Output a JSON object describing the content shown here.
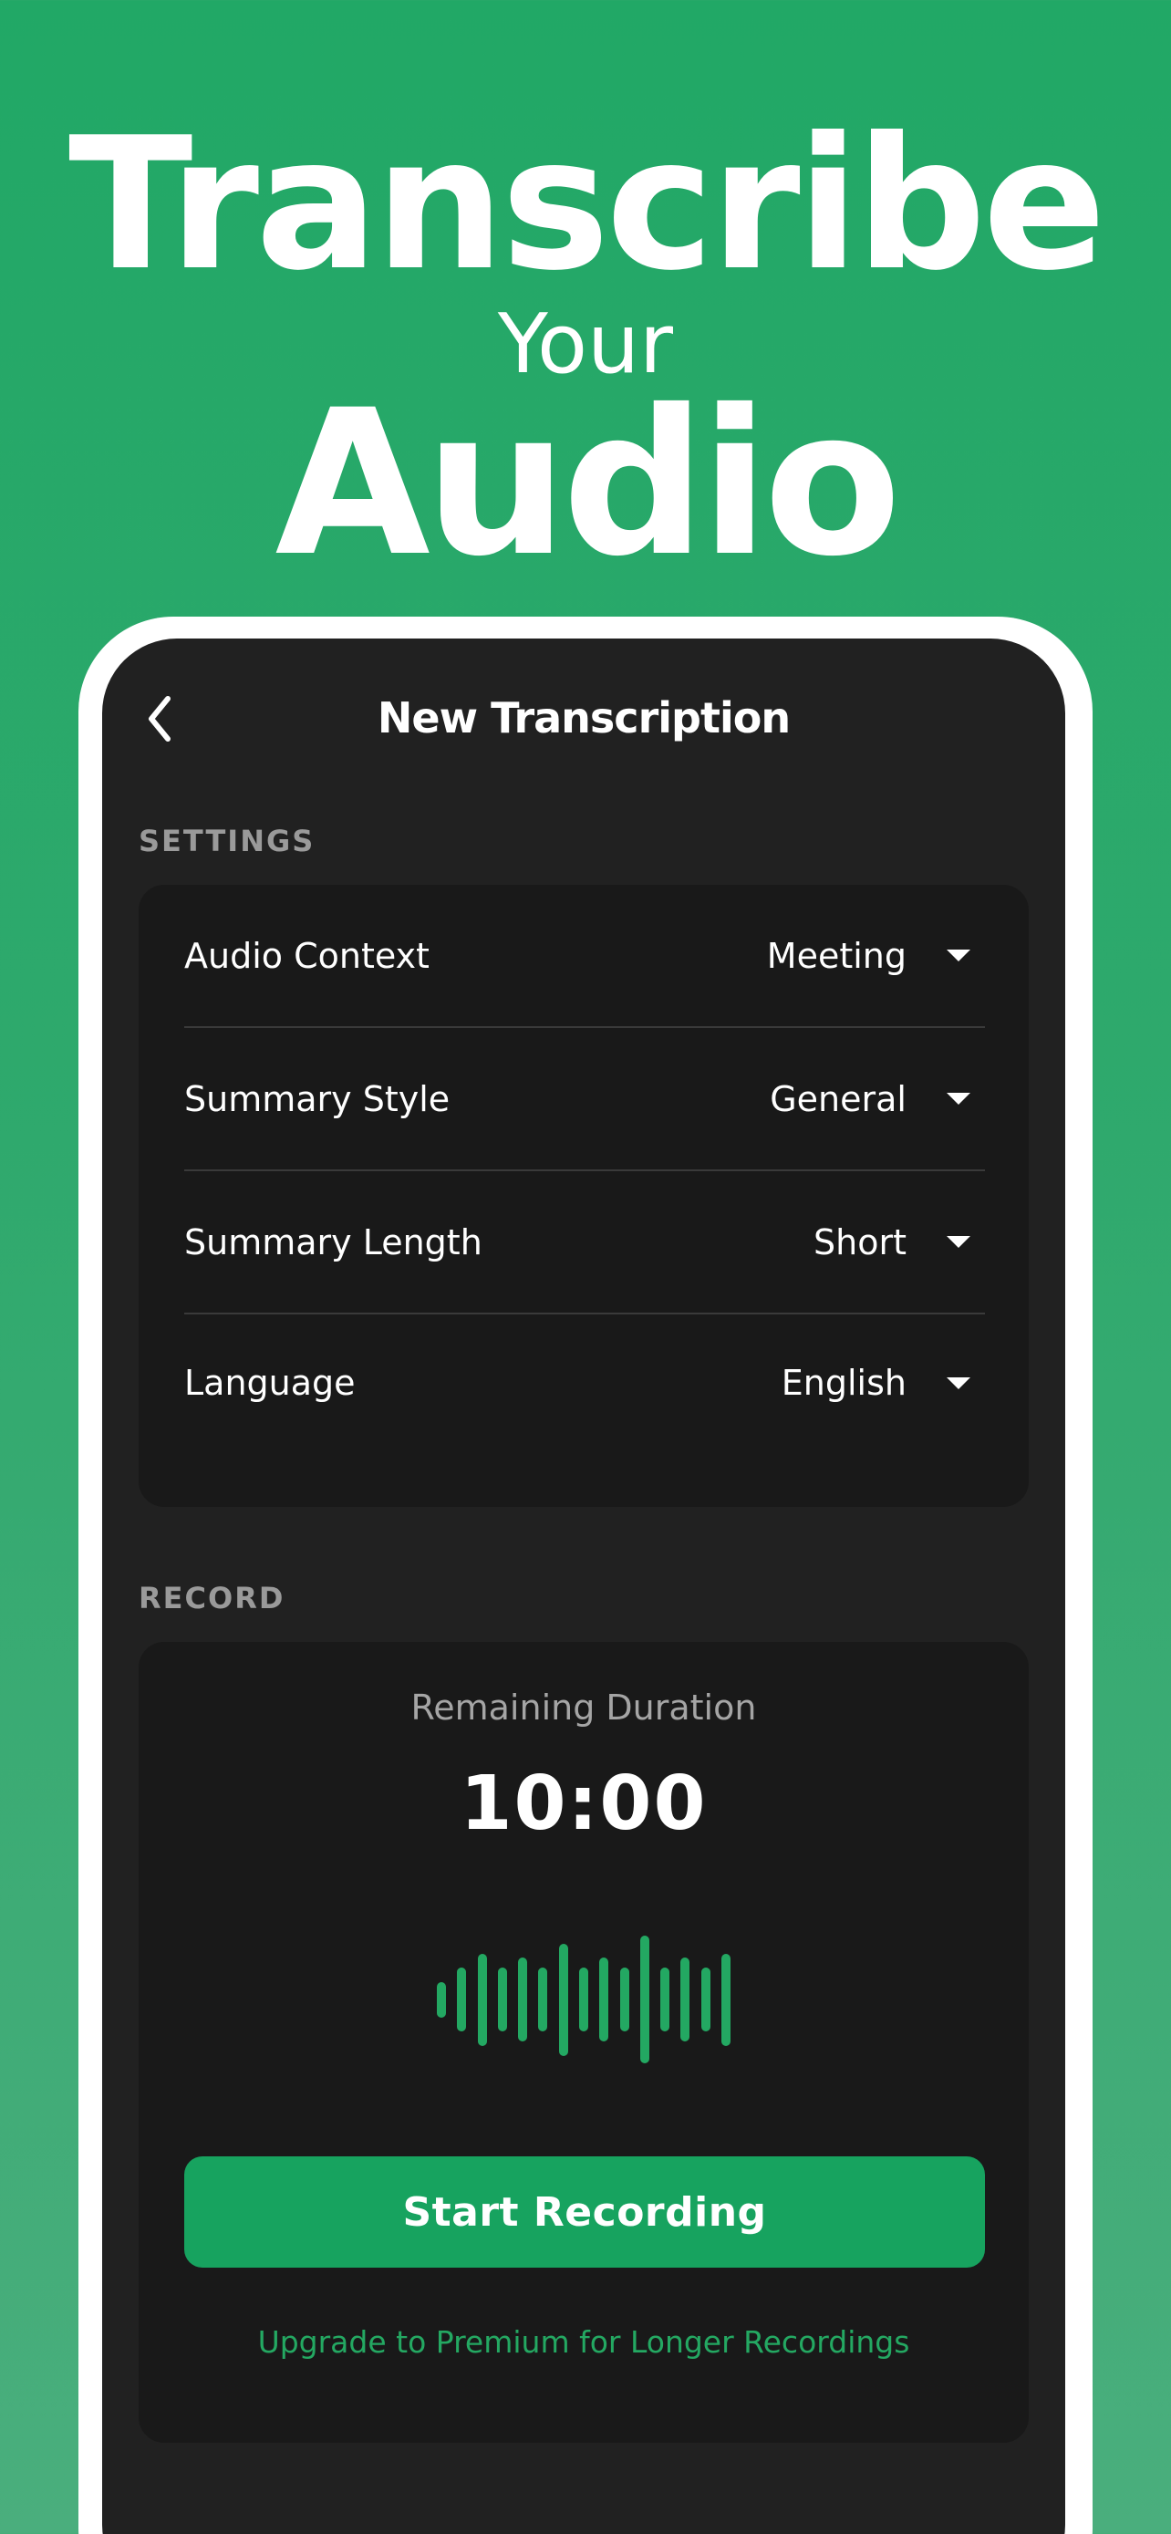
{
  "hero": {
    "line1": "Transcribe",
    "line2": "Your",
    "line3": "Audio"
  },
  "nav": {
    "back_icon": "chevron-left-icon",
    "title": "New Transcription"
  },
  "settings": {
    "section_label": "SETTINGS",
    "rows": [
      {
        "label": "Audio Context",
        "value": "Meeting"
      },
      {
        "label": "Summary Style",
        "value": "General"
      },
      {
        "label": "Summary Length",
        "value": "Short"
      },
      {
        "label": "Language",
        "value": "English"
      }
    ]
  },
  "record": {
    "section_label": "RECORD",
    "remaining_label": "Remaining Duration",
    "timer": "10:00",
    "waveform_levels": [
      0.28,
      0.5,
      0.72,
      0.5,
      0.66,
      0.5,
      0.88,
      0.5,
      0.66,
      0.5,
      1.0,
      0.5,
      0.66,
      0.5,
      0.72
    ],
    "start_button": "Start Recording",
    "upgrade_link": "Upgrade to Premium for Longer Recordings"
  },
  "colors": {
    "accent": "#17a35f",
    "background": "#21a866",
    "screen": "#212121",
    "card": "#191919"
  }
}
